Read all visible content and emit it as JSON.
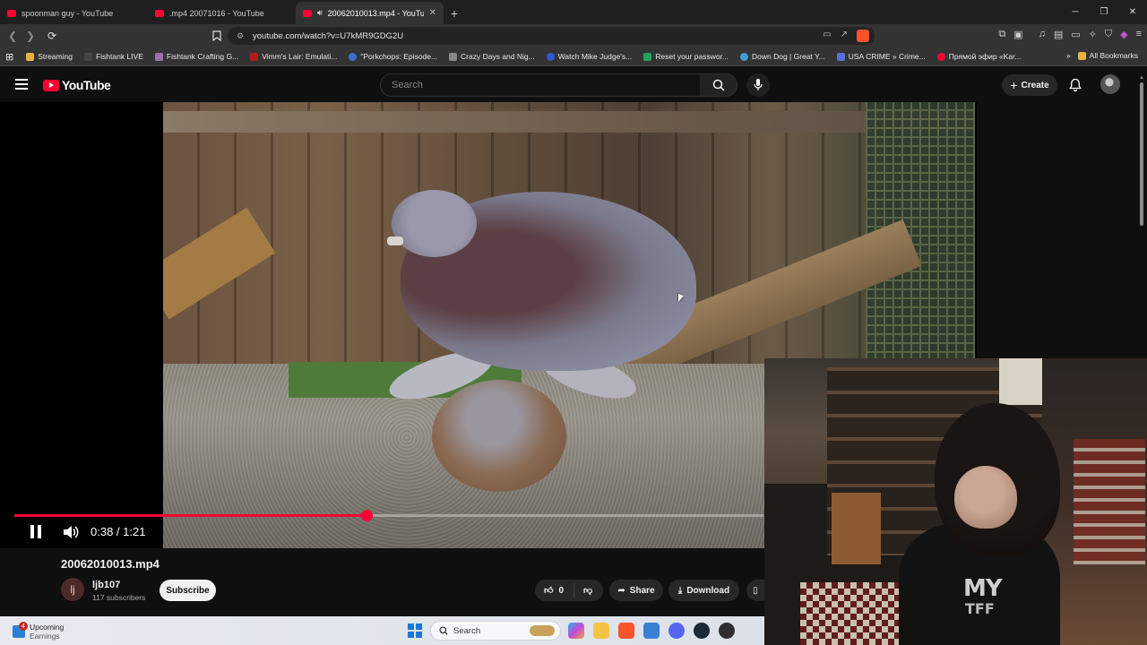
{
  "browser": {
    "tabs": [
      {
        "title": "spoonman guy - YouTube",
        "active": false
      },
      {
        "title": ".mp4 20071016 - YouTube",
        "active": false
      },
      {
        "title": "20062010013.mp4 - YouTube",
        "active": true
      }
    ],
    "new_tab_label": "+",
    "url": "youtube.com/watch?v=U7kMR9GDG2U",
    "bookmarks": [
      {
        "label": "Streaming",
        "color": "#e8b33a"
      },
      {
        "label": "Fishtank LIVE",
        "color": "#222222"
      },
      {
        "label": "Fishtank Crafting G...",
        "color": "#9b6fb0"
      },
      {
        "label": "Vimm's Lair: Emulati...",
        "color": "#b31b1b"
      },
      {
        "label": "\"Porkchops: Episode...",
        "color": "#3b6fd1"
      },
      {
        "label": "Crazy Days and Nig...",
        "color": "#888888"
      },
      {
        "label": "Watch Mike Judge's...",
        "color": "#2a5bd7"
      },
      {
        "label": "Reset your passwor...",
        "color": "#1fa35a"
      },
      {
        "label": "Down Dog | Great Y...",
        "color": "#3aa0d8"
      },
      {
        "label": "USA CRIME » Crime...",
        "color": "#5b6ed6"
      },
      {
        "label": "Прямой эфир «Kar...",
        "color": "#ff0033"
      }
    ],
    "all_bookmarks_label": "All Bookmarks"
  },
  "youtube": {
    "logo_text": "YouTube",
    "search_placeholder": "Search",
    "create_label": "Create"
  },
  "player": {
    "current_time": "0:38",
    "duration": "1:21",
    "time_display": "0:38 / 1:21",
    "progress_fraction": 0.47,
    "state": "playing"
  },
  "video": {
    "title": "20062010013.mp4",
    "channel_initial": "lj",
    "channel_name": "ljb107",
    "subscribers": "117 subscribers",
    "subscribe_label": "Subscribe",
    "like_count": "0",
    "share_label": "Share",
    "download_label": "Download"
  },
  "webcam": {
    "shirt_text_line1": "MY",
    "shirt_text_line2": "TFF"
  },
  "taskbar": {
    "upcoming_title": "Upcoming",
    "upcoming_subtitle": "Earnings",
    "upcoming_badge": "4",
    "search_label": "Search"
  },
  "colors": {
    "accent_red": "#ff0033",
    "background": "#0f0f0f"
  }
}
